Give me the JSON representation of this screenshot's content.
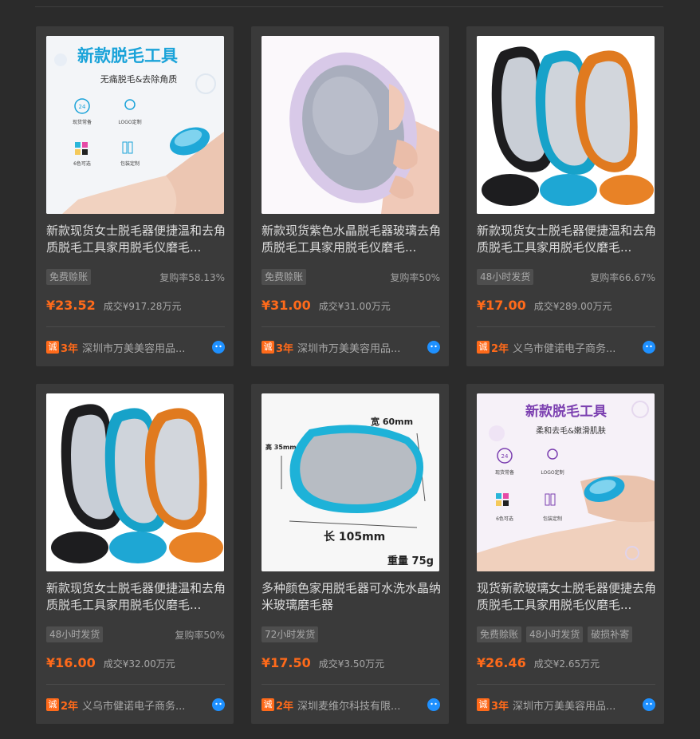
{
  "accent_color": "#ff6a1a",
  "chat_icon": "chat-bubble-icon",
  "products": [
    {
      "title": "新款现货女士脱毛器便捷温和去角质脱毛工具家用脱毛仪磨毛...",
      "image": {
        "kind": "banner",
        "headline": "新款脱毛工具",
        "subline": "无痛脱毛&去除角质",
        "features": [
          "现货常备",
          "LOGO定制",
          "6色可选",
          "包装定制"
        ],
        "badge": "24"
      },
      "tags": [
        "免费赊账"
      ],
      "repurchase": "复购率58.13%",
      "price": "¥23.52",
      "deal": "成交¥917.28万元",
      "years": "3年",
      "supplier": "深圳市万美美容用品..."
    },
    {
      "title": "新款现货紫色水晶脱毛器玻璃去角质脱毛工具家用脱毛仪磨毛...",
      "image": {
        "kind": "hand"
      },
      "tags": [
        "免费赊账"
      ],
      "repurchase": "复购率50%",
      "price": "¥31.00",
      "deal": "成交¥31.00万元",
      "years": "3年",
      "supplier": "深圳市万美美容用品..."
    },
    {
      "title": "新款现货女士脱毛器便捷温和去角质脱毛工具家用脱毛仪磨毛...",
      "image": {
        "kind": "trio"
      },
      "tags": [
        "48小时发货"
      ],
      "repurchase": "复购率66.67%",
      "price": "¥17.00",
      "deal": "成交¥289.00万元",
      "years": "2年",
      "supplier": "义乌市健诺电子商务..."
    },
    {
      "title": "新款现货女士脱毛器便捷温和去角质脱毛工具家用脱毛仪磨毛...",
      "image": {
        "kind": "trio"
      },
      "tags": [
        "48小时发货"
      ],
      "repurchase": "复购率50%",
      "price": "¥16.00",
      "deal": "成交¥32.00万元",
      "years": "2年",
      "supplier": "义乌市健诺电子商务..."
    },
    {
      "title": "多种颜色家用脱毛器可水洗水晶纳米玻璃磨毛器",
      "image": {
        "kind": "dims",
        "width": "宽 60mm",
        "height": "高 35mm",
        "length": "长 105mm",
        "weight": "重量 75g"
      },
      "tags": [
        "72小时发货"
      ],
      "repurchase": "",
      "price": "¥17.50",
      "deal": "成交¥3.50万元",
      "years": "2年",
      "supplier": "深圳麦维尔科技有限..."
    },
    {
      "title": "现货新款玻璃女士脱毛器便捷去角质脱毛工具家用脱毛仪磨毛...",
      "image": {
        "kind": "banner2",
        "headline": "新款脱毛工具",
        "subline": "柔和去毛&嫩滑肌肤",
        "features": [
          "现货常备",
          "LOGO定制",
          "6色可选",
          "包装定制"
        ],
        "badge": "24"
      },
      "tags": [
        "免费赊账",
        "48小时发货",
        "破损补寄"
      ],
      "repurchase": "",
      "price": "¥26.46",
      "deal": "成交¥2.65万元",
      "years": "3年",
      "supplier": "深圳市万美美容用品..."
    }
  ]
}
